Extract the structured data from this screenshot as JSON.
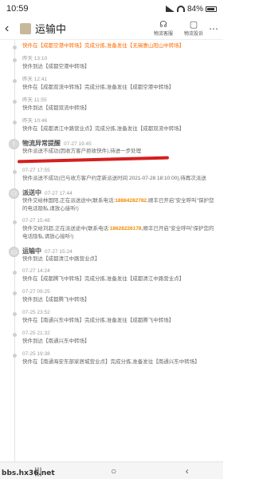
{
  "status": {
    "time": "10:59",
    "battery": "84%"
  },
  "header": {
    "title": "运输中",
    "service_label": "物流客服",
    "complaint_label": "物流投诉"
  },
  "entries": [
    {
      "time": "",
      "text": "快件在【成都空港中转场】完成分拣,准备发往【无锡惠山阳山中转场】"
    },
    {
      "time": "昨天 13:10",
      "text": "快件到达【成都空港中转场】"
    },
    {
      "time": "昨天 12:41",
      "text": "快件在【成都双流中转场】完成分拣,准备发往【成都空港中转场】"
    },
    {
      "time": "昨天 11:55",
      "text": "快件到达【成都双流中转场】"
    },
    {
      "time": "昨天 10:46",
      "text": "快件在【成都清江中路营业点】完成分拣,准备发往【成都双流中转场】"
    }
  ],
  "exception": {
    "title": "物流异常提醒",
    "time": "07-27 19:45",
    "text": "快件派送不成功(因收方客户拒收快件),待进一步处理",
    "sub_time": "07-27 17:55",
    "sub_text": "快件派送不成功(已与收方客户约定新派送时间 2021-07-28 18:10:00),待再次派送"
  },
  "delivery": {
    "title": "派送中",
    "time": "07-27 17:44",
    "text_pre": "快件交给林国阳,正在派送途中(联系电话:",
    "phone": "18884282782",
    "text_post": ",顺丰已开启\"安全呼叫\"保护您的电话隐私,请放心接听!)",
    "sub_time": "07-27 15:48",
    "sub_text_pre": "快件交给刘超,正在派送途中(联系电话:",
    "sub_phone": "18628226178",
    "sub_text_post": ",顺丰已开启\"安全呼叫\"保护您的电话隐私,请放心接听!)"
  },
  "transit": {
    "title": "运输中",
    "time": "07-27 15:24",
    "text": "快件到达【成都清江中路营业点】"
  },
  "entries2": [
    {
      "time": "07-27 14:24",
      "text": "快件在【成都腾飞中转场】完成分拣,准备发往【成都清江中路营业点】"
    },
    {
      "time": "07-27 09:25",
      "text": "快件到达【成都腾飞中转场】"
    },
    {
      "time": "07-25 23:52",
      "text": "快件在【南通兴东中转场】完成分拣,准备发往【成都腾飞中转场】"
    },
    {
      "time": "07-25 21:32",
      "text": "快件到达【南通兴东中转场】"
    },
    {
      "time": "07-25 19:38",
      "text": "快件在【南通海安东部家居城营业点】完成分拣,准备发往【南通兴东中转场】"
    }
  ],
  "watermark": "bbs.hx36.net"
}
